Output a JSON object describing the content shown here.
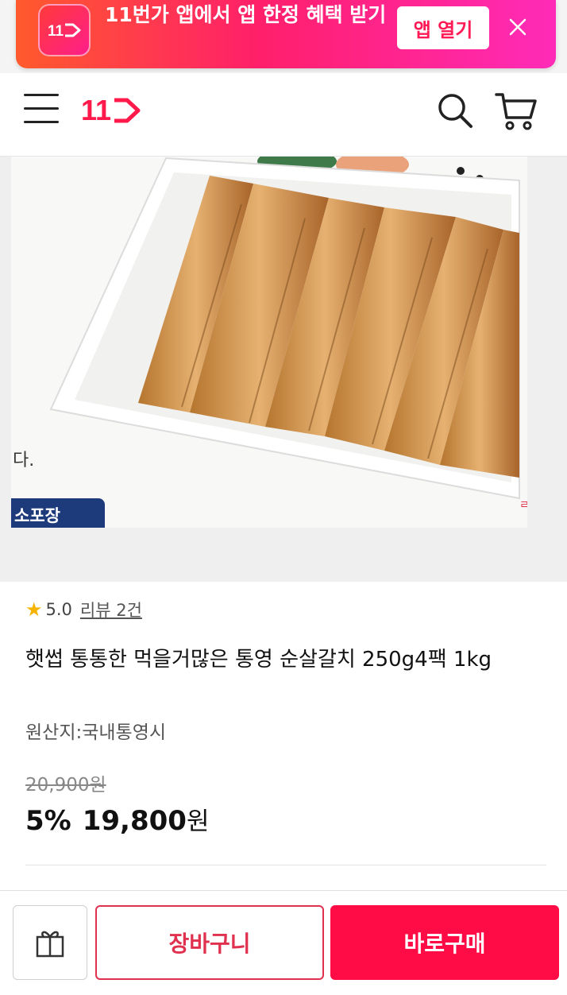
{
  "promo_banner": {
    "logo_text": "11",
    "text": "11번가 앱에서 앱 한정 혜택 받기",
    "open_button": "앱 열기",
    "close_icon": "close-icon"
  },
  "header": {
    "menu_icon": "hamburger-menu-icon",
    "logo_text": "11",
    "search_icon": "search-icon",
    "cart_icon": "cart-icon"
  },
  "product_image": {
    "caption_fragment": "다.",
    "badge_fragment": "소포장",
    "right_edge_fragment": "ㄹ"
  },
  "product": {
    "rating": "5.0",
    "review_link": "리뷰 2건",
    "title": "햇썹 통통한 먹을거많은 통영 순살갈치 250g4팩 1kg",
    "origin": "원산지:국내통영시",
    "original_price": "20,900원",
    "discount": "5%",
    "price": "19,800",
    "price_unit": "원"
  },
  "bottom_bar": {
    "gift_icon": "gift-icon",
    "cart_button": "장바구니",
    "buy_button": "바로구매"
  },
  "colors": {
    "brand_red": "#ff0b45",
    "cart_border": "#e0314f",
    "star": "#f6b400",
    "promo_gradient_start": "#ff5a2c",
    "promo_gradient_end": "#ff2bb8"
  }
}
